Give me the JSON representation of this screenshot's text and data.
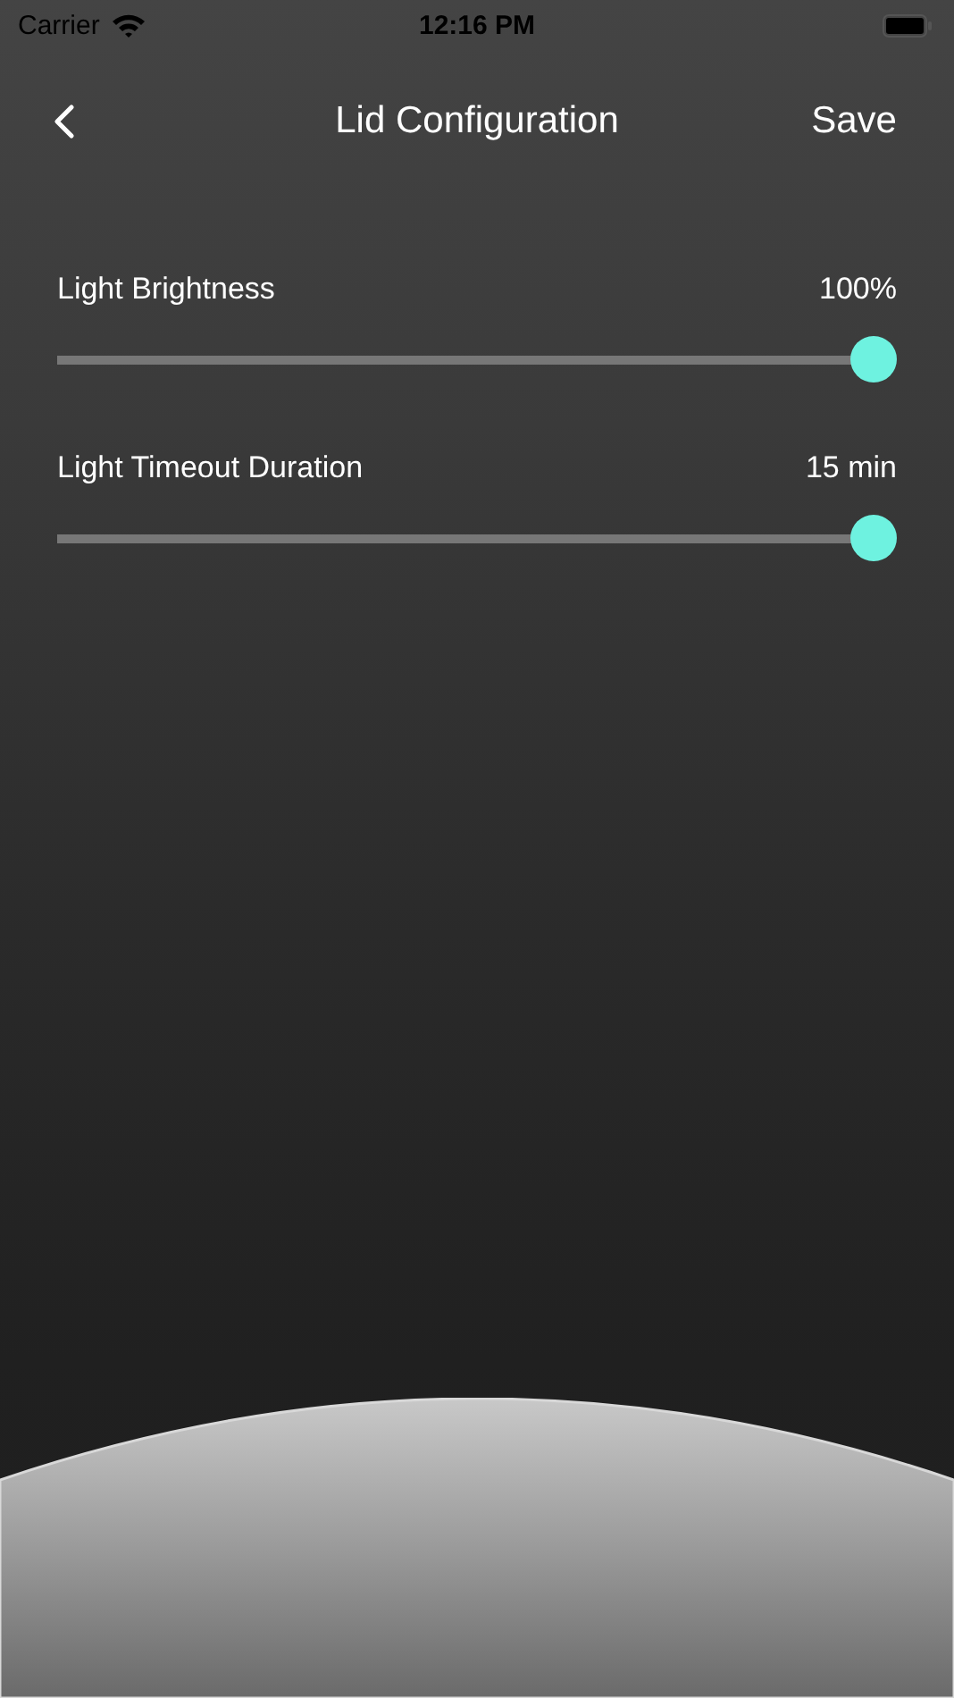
{
  "status_bar": {
    "carrier": "Carrier",
    "time": "12:16 PM"
  },
  "nav": {
    "title": "Lid Configuration",
    "action": "Save"
  },
  "settings": [
    {
      "label": "Light Brightness",
      "reading": "100%",
      "level": 1
    },
    {
      "label": "Light Timeout Duration",
      "reading": "15 min",
      "level": 1
    }
  ]
}
